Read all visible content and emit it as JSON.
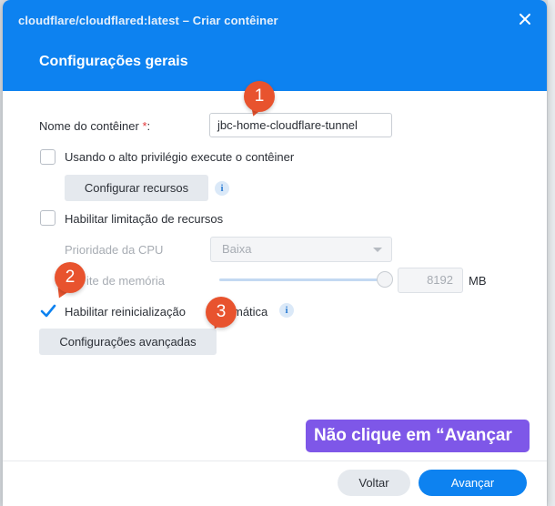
{
  "dialog": {
    "title": "cloudflare/cloudflared:latest – Criar contêiner",
    "section_title": "Configurações gerais"
  },
  "form": {
    "container_name_label": "Nome do contêiner",
    "required_mark": "*",
    "label_colon": ":",
    "container_name_value": "jbc-home-cloudflare-tunnel",
    "high_privilege_label": "Usando o alto privilégio execute o contêiner",
    "high_privilege_checked": false,
    "configure_resources_label": "Configurar recursos",
    "resource_limit_label": "Habilitar limitação de recursos",
    "resource_limit_checked": false,
    "cpu_priority_label": "Prioridade da CPU",
    "cpu_priority_value": "Baixa",
    "memory_limit_label": "Limite de memória",
    "memory_limit_visible": "ite de memória",
    "memory_value": "8192",
    "memory_unit": "MB",
    "auto_restart_label": "Habilitar reinicialização automática",
    "auto_restart_visible_a": "Habilitar reinicialização",
    "auto_restart_visible_b": "mática",
    "auto_restart_checked": true,
    "advanced_settings_label": "Configurações avançadas"
  },
  "footer": {
    "back_label": "Voltar",
    "next_label": "Avançar"
  },
  "annotations": {
    "badge_1": "1",
    "badge_2": "2",
    "badge_3": "3",
    "callout_text": "Não clique em “Avançar"
  },
  "icons": [
    "close-icon",
    "info-icon",
    "check-icon",
    "chevron-down-icon"
  ],
  "colors": {
    "header_blue": "#0d82f0",
    "badge_orange": "#e8532e",
    "callout_purple": "#7e57e8",
    "required_red": "#e2373a"
  }
}
